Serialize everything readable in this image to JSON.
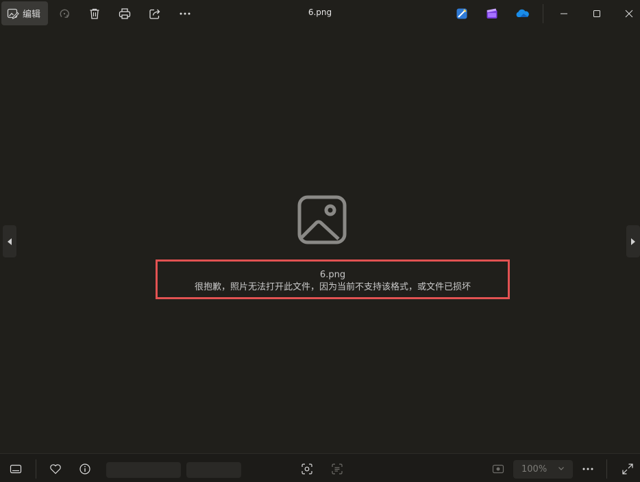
{
  "window": {
    "title": "6.png"
  },
  "toolbar": {
    "edit_label": "编辑",
    "icons": [
      "edit-photo-icon",
      "rotate-icon",
      "delete-icon",
      "print-icon",
      "share-icon",
      "more-icon"
    ],
    "app_icons": [
      "designer-app-icon",
      "clipchamp-app-icon",
      "onedrive-icon"
    ],
    "window_controls": [
      "minimize-icon",
      "maximize-icon",
      "close-icon"
    ]
  },
  "viewer": {
    "file_name": "6.png",
    "error_message": "很抱歉，照片无法打开此文件，因为当前不支持该格式，或文件已损坏",
    "highlight_color": "#e25252"
  },
  "bottombar": {
    "zoom_value": "100%",
    "icons": [
      "filmstrip-icon",
      "favorite-icon",
      "info-icon",
      "visual-search-icon",
      "text-scan-icon",
      "fit-to-window-icon",
      "more-icon",
      "fullscreen-icon"
    ]
  }
}
